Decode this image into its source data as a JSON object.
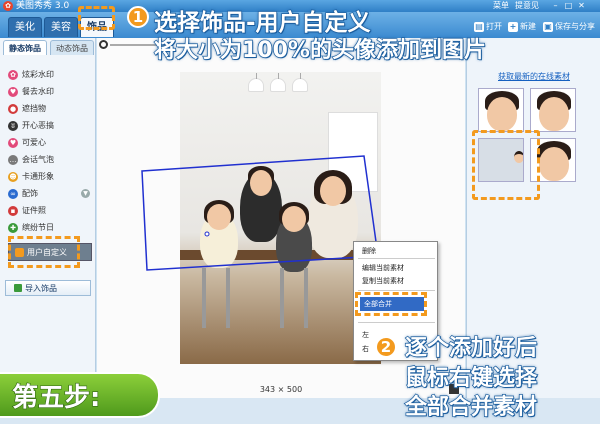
{
  "titlebar": {
    "app_title": "美图秀秀 3.0",
    "menu_label": "菜单",
    "feedback_label": "提意见"
  },
  "tabs": [
    {
      "label": "美化"
    },
    {
      "label": "美容"
    },
    {
      "label": "饰品",
      "active": true
    }
  ],
  "toolbar": {
    "open_label": "打开",
    "new_label": "新建",
    "save_share_label": "保存与分享"
  },
  "left_panel": {
    "tab_static": "静态饰品",
    "tab_dynamic": "动态饰品",
    "items": [
      {
        "label": "炫彩水印",
        "icon": "flower-icon",
        "color": "#e24a7a"
      },
      {
        "label": "餐去水印",
        "icon": "heart-icon",
        "color": "#e24a7a"
      },
      {
        "label": "遮挡物",
        "icon": "mask-icon",
        "color": "#d23b3b"
      },
      {
        "label": "开心恶搞",
        "icon": "beard-icon",
        "color": "#333333"
      },
      {
        "label": "可爱心",
        "icon": "heart-icon",
        "color": "#e24a7a"
      },
      {
        "label": "会话气泡",
        "icon": "bubble-icon",
        "color": "#7a7a7a"
      },
      {
        "label": "卡通形象",
        "icon": "cartoon-icon",
        "color": "#e8a020"
      },
      {
        "label": "配饰",
        "icon": "glasses-icon",
        "color": "#2a6bd0",
        "expandable": true
      },
      {
        "label": "证件照",
        "icon": "id-photo-icon",
        "color": "#d23b3b"
      },
      {
        "label": "缤纷节日",
        "icon": "gift-icon",
        "color": "#3a9a3a"
      }
    ],
    "custom_item_label": "用户自定义",
    "import_button_label": "导入饰品"
  },
  "canvas": {
    "size_readout": "343 × 500"
  },
  "context_menu": {
    "items": [
      {
        "label": "删除"
      },
      {
        "label": "编辑当前素材"
      },
      {
        "label": "复制当前素材"
      },
      {
        "label": "全部合并",
        "highlighted": true
      },
      {
        "label": "左"
      },
      {
        "label": "右"
      }
    ]
  },
  "right_panel": {
    "online_link": "获取最新的在线素材"
  },
  "annotations": {
    "step1_number": "1",
    "step1_line1": "选择饰品-用户自定义",
    "step1_line2": "将大小为100%的头像添加到图片",
    "step2_number": "2",
    "step2_line1": "逐个添加好后",
    "step2_line2": "鼠标右键选择",
    "step2_line3": "全部合并素材",
    "step_banner": "第五步:"
  },
  "colors": {
    "accent_orange": "#f39a1e",
    "title_blue": "#2f7fc6",
    "highlight_blue": "#316ac5",
    "banner_green": "#6fb82a"
  }
}
